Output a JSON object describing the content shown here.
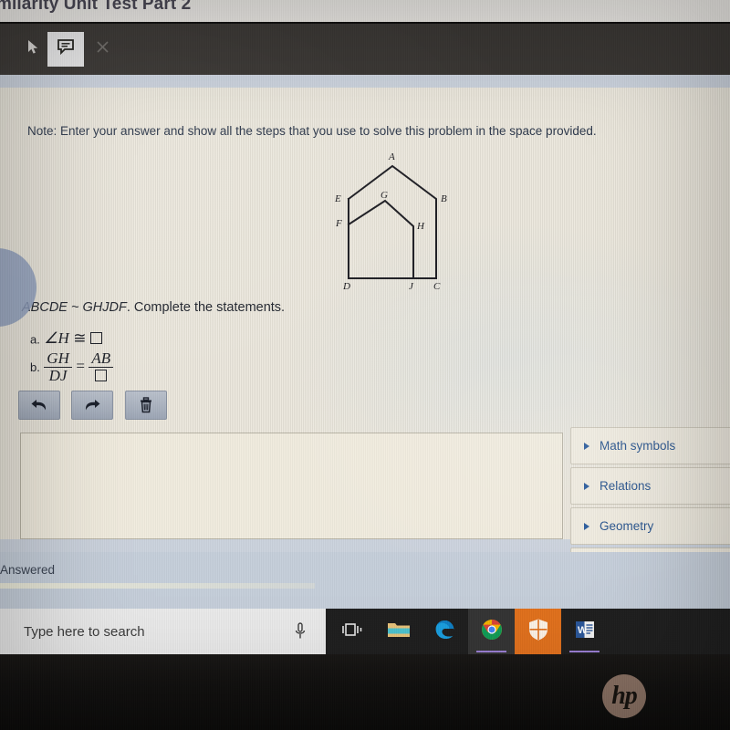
{
  "titlebar": {
    "title": "milarity Unit Test Part 2"
  },
  "annotation_toolbar": {
    "cursor_icon": "cursor-arrow-icon",
    "note_icon": "comment-note-icon",
    "close_icon": "close-x-icon"
  },
  "content": {
    "note": "Note: Enter your answer and show all the steps that you use to solve this problem in the space provided.",
    "similarity_statement_prefix": "ABCDE ~ GHJDF",
    "similarity_statement_suffix": ". Complete the statements.",
    "statement_a": {
      "label": "a.",
      "angle_symbol": "∠",
      "vertex": "H",
      "relation": "≅"
    },
    "statement_b": {
      "label": "b.",
      "left_num": "GH",
      "left_den": "DJ",
      "equals": "=",
      "right_num": "AB"
    }
  },
  "figure": {
    "name": "house-shaped-similar-polygons",
    "labels": {
      "A": "A",
      "B": "B",
      "C": "C",
      "D": "D",
      "E": "E",
      "F": "F",
      "G": "G",
      "H": "H",
      "J": "J"
    },
    "stroke_color": "#1e1e24"
  },
  "edit_buttons": [
    {
      "name": "undo-button",
      "icon": "undo-arrow-icon"
    },
    {
      "name": "redo-button",
      "icon": "redo-arrow-icon"
    },
    {
      "name": "delete-button",
      "icon": "trash-icon"
    }
  ],
  "answer_area": {
    "value": "",
    "placeholder": ""
  },
  "symbol_panel": {
    "items": [
      {
        "label": "Math symbols",
        "icon": "chevron-right-icon"
      },
      {
        "label": "Relations",
        "icon": "chevron-right-icon"
      },
      {
        "label": "Geometry",
        "icon": "chevron-right-icon"
      }
    ],
    "accent_color": "#25528d"
  },
  "status": {
    "text": "Answered"
  },
  "taskbar": {
    "search_placeholder": "Type here to search",
    "mic_icon": "microphone-icon",
    "buttons": [
      {
        "name": "task-view-button",
        "icon": "task-view-icon"
      },
      {
        "name": "file-explorer-button",
        "icon": "folder-icon"
      },
      {
        "name": "edge-button",
        "icon": "edge-icon"
      },
      {
        "name": "chrome-button",
        "icon": "chrome-icon"
      },
      {
        "name": "defender-button",
        "icon": "shield-icon"
      },
      {
        "name": "word-button",
        "icon": "word-icon"
      }
    ]
  },
  "device": {
    "brand_logo": "hp"
  }
}
